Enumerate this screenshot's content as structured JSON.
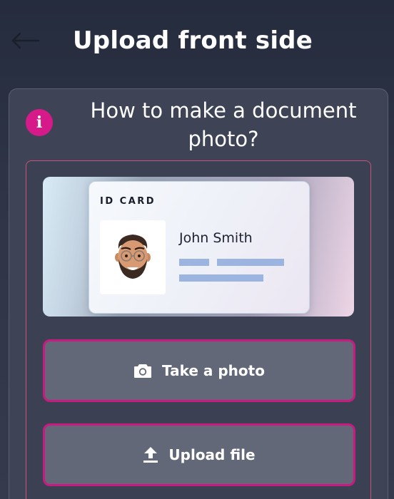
{
  "header": {
    "title": "Upload front side",
    "back_icon": "arrow-left-icon"
  },
  "guide": {
    "info_icon": "info-icon",
    "heading": "How to make a document photo?"
  },
  "id_card": {
    "label": "ID CARD",
    "holder_name": "John Smith",
    "avatar": "memoji-avatar"
  },
  "actions": {
    "take_photo_label": "Take a photo",
    "take_photo_icon": "camera-icon",
    "upload_file_label": "Upload file",
    "upload_file_icon": "upload-icon"
  },
  "colors": {
    "accent": "#d61a8a",
    "background": "#2f3547",
    "card": "#3e4456",
    "button": "#626877",
    "placeholder_bar": "#9bb5e0"
  }
}
